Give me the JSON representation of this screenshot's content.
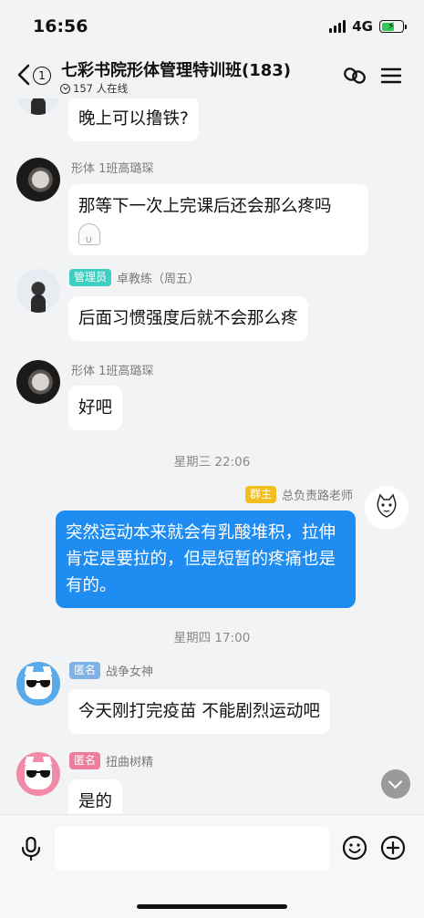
{
  "status": {
    "time": "16:56",
    "network": "4G"
  },
  "header": {
    "unread_count": "1",
    "title": "七彩书院形体管理特训班(183)",
    "online": "157 人在线"
  },
  "messages": [
    {
      "text": "晚上可以撸铁?"
    },
    {
      "sender": "形体 1班高璐琛",
      "text": "那等下一次上完课后还会那么疼吗"
    },
    {
      "badge": "管理员",
      "sender": "卓教练（周五）",
      "text": "后面习惯强度后就不会那么疼"
    },
    {
      "sender": "形体 1班高璐琛",
      "text": "好吧"
    },
    {
      "badge": "群主",
      "sender": "总负责路老师",
      "text": "突然运动本来就会有乳酸堆积，拉伸肯定是要拉的，但是短暂的疼痛也是有的。"
    },
    {
      "badge": "匿名",
      "sender": "战争女神",
      "text": "今天刚打完疫苗 不能剧烈运动吧"
    },
    {
      "badge": "匿名",
      "sender": "扭曲树精",
      "text": "是的"
    }
  ],
  "timestamps": [
    "星期三 22:06",
    "星期四 17:00"
  ],
  "colors": {
    "my_bubble": "#1f8cf1",
    "admin_badge": "#3fcfc0",
    "owner_badge": "#f4bd1f",
    "anon_badge_blue": "#7fb3e6",
    "anon_badge_pink": "#ef7c9c"
  },
  "icons": [
    "back-arrow-icon",
    "link-icon",
    "menu-icon",
    "voice-icon",
    "emoji-icon",
    "plus-icon",
    "scroll-down-icon"
  ]
}
